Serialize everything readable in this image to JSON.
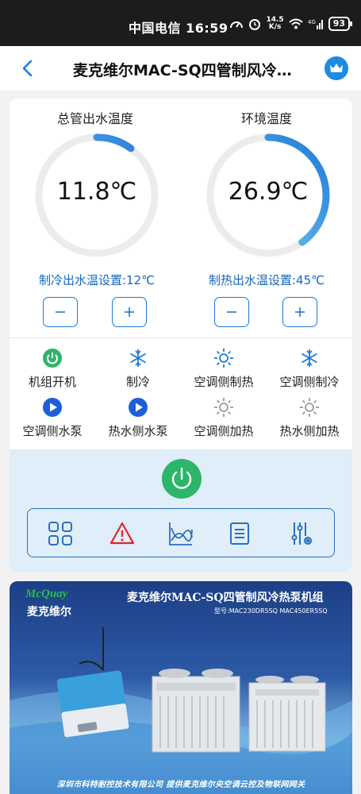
{
  "status_bar": {
    "carrier_time": "中国电信 16:59",
    "speed_top": "14.5",
    "speed_bottom": "K/s",
    "battery": "93"
  },
  "header": {
    "title": "麦克维尔MAC-SQ四管制风冷…"
  },
  "gauges": [
    {
      "title": "总管出水温度",
      "value": "11.8℃",
      "level": 0.1
    },
    {
      "title": "环境温度",
      "value": "26.9℃",
      "level": 0.4
    }
  ],
  "setpoints": {
    "cooling": "制冷出水温设置:12℃",
    "heating": "制热出水温设置:45℃"
  },
  "stepper": {
    "minus": "−",
    "plus": "+"
  },
  "statuses": [
    {
      "label": "机组开机",
      "icon": "power-on-icon",
      "color": "#2db56a"
    },
    {
      "label": "制冷",
      "icon": "snowflake-icon",
      "color": "#1e7ad8"
    },
    {
      "label": "空调侧制热",
      "icon": "sun-icon",
      "color": "#1e7ad8"
    },
    {
      "label": "空调侧制冷",
      "icon": "snowflake-icon",
      "color": "#1e7ad8"
    },
    {
      "label": "空调侧水泵",
      "icon": "play-pump-icon",
      "color": "#1e5fd8"
    },
    {
      "label": "热水侧水泵",
      "icon": "play-pump-icon",
      "color": "#1e5fd8"
    },
    {
      "label": "空调侧加热",
      "icon": "sun-icon",
      "color": "#9a9a9a"
    },
    {
      "label": "热水侧加热",
      "icon": "sun-icon",
      "color": "#9a9a9a"
    }
  ],
  "toolbar": [
    "grid-icon",
    "alarm-warning-icon",
    "trend-chart-icon",
    "list-document-icon",
    "settings-sliders-icon"
  ],
  "banner": {
    "brand_en": "McQuay",
    "brand_cn": "麦克维尔",
    "title": "麦克维尔MAC-SQ四管制风冷热泵机组",
    "model": "型号:MAC230DR5SQ  MAC450ER5SQ",
    "footer": "深圳市科特耐控技术有限公司  提供麦克维尔央空调云控及物联网网关"
  },
  "colors": {
    "accent": "#1e7ad8",
    "power_green": "#2db56a",
    "alarm_red": "#e0252b",
    "panel_bg": "#dfeef8"
  }
}
